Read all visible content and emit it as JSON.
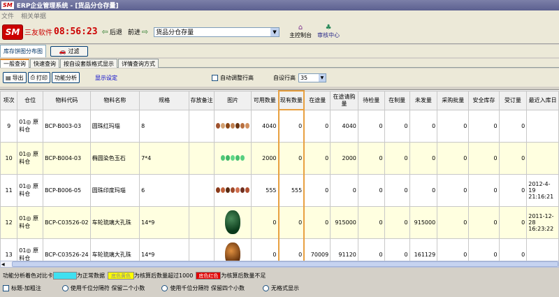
{
  "window": {
    "logo": "SM",
    "title": "ERP企业管理系统 - [货品分仓存量]"
  },
  "menu": {
    "items": [
      "文件",
      "相关单据"
    ]
  },
  "toolbar": {
    "brand_logo": "SM",
    "brand_name": "三友软件",
    "clock": "08:56:23",
    "back_label": "后退",
    "forward_label": "前进",
    "module_value": "货品分仓存量",
    "console_label": "主控制台",
    "audit_label": "审核中心"
  },
  "subbar": {
    "view_tab": "库存饼图分布图",
    "filter_label": "过滤"
  },
  "tabs": [
    "一般查询",
    "快速查询",
    "按自设套版格式显示",
    "详情查询方式"
  ],
  "actions": {
    "export_label": "导出",
    "print_label": "打印",
    "analysis_label": "功能分析",
    "show_settings": "显示设定",
    "auto_adjust_label": "自动调整行高",
    "row_height_label": "自设行高",
    "row_height_value": "35"
  },
  "table": {
    "columns": [
      "项次",
      "仓位",
      "物料代码",
      "物料名称",
      "规格",
      "存放备注",
      "图片",
      "可用数量",
      "现有数量",
      "在途量",
      "在途请购量",
      "待检量",
      "在制量",
      "未发量",
      "采购批量",
      "安全库存",
      "受订量",
      "最近入库日"
    ],
    "rows": [
      {
        "no": "9",
        "wh": "01◎ 原料仓",
        "code": "BCP-B003-03",
        "name": "圆珠红玛瑙",
        "spec": "8",
        "note": "",
        "img": "beads-brown",
        "avail": "4040",
        "onhand": "0",
        "transit": "0",
        "transit_req": "4040",
        "inspect": "0",
        "making": "0",
        "unsent": "0",
        "batch": "0",
        "safety": "0",
        "ordered": "0",
        "lastin": ""
      },
      {
        "no": "10",
        "wh": "01◎ 原料仓",
        "code": "BCP-B004-03",
        "name": "椭圆染色玉石",
        "spec": "7*4",
        "note": "",
        "img": "beads-green",
        "avail": "2000",
        "onhand": "0",
        "transit": "0",
        "transit_req": "2000",
        "inspect": "0",
        "making": "0",
        "unsent": "0",
        "batch": "0",
        "safety": "0",
        "ordered": "0",
        "lastin": ""
      },
      {
        "no": "11",
        "wh": "01◎ 原料仓",
        "code": "BCP-B006-05",
        "name": "圆珠印度玛瑙",
        "spec": "6",
        "note": "",
        "img": "beads-mixed",
        "avail": "555",
        "onhand": "555",
        "transit": "0",
        "transit_req": "0",
        "inspect": "0",
        "making": "0",
        "unsent": "0",
        "batch": "0",
        "safety": "0",
        "ordered": "0",
        "lastin": "2012-4-19 21:16:21"
      },
      {
        "no": "12",
        "wh": "01◎ 原料仓",
        "code": "BCP-C03526-02",
        "name": "车轮琉璃大孔珠",
        "spec": "14*9",
        "note": "",
        "img": "jewel-green",
        "avail": "0",
        "onhand": "0",
        "transit": "0",
        "transit_req": "915000",
        "inspect": "0",
        "making": "0",
        "unsent": "915000",
        "batch": "0",
        "safety": "0",
        "ordered": "0",
        "lastin": "2011-12-28 16:23:22"
      },
      {
        "no": "13",
        "wh": "01◎ 原料仓",
        "code": "BCP-C03526-24",
        "name": "车轮琉璃大孔珠",
        "spec": "14*9",
        "note": "",
        "img": "jewel-amber",
        "avail": "0",
        "onhand": "0",
        "transit": "70009",
        "transit_req": "91120",
        "inspect": "0",
        "making": "0",
        "unsent": "161129",
        "batch": "0",
        "safety": "0",
        "ordered": "0",
        "lastin": ""
      }
    ]
  },
  "legend": {
    "prefix": "功能分析着色对比卡",
    "cyan_swatch": "",
    "cyan_text": "为正常数据",
    "yellow_swatch": "底色黄色",
    "yellow_text": "为核算后数量超过1000",
    "red_swatch": "底色红色",
    "red_text": "为核算后数量不足",
    "colors": {
      "cyan": "#40e0f0",
      "yellow": "#ffff00",
      "red": "#e00000"
    }
  },
  "bottom": {
    "title_bold": "标题-加粗注",
    "opt1": "使用千位分隔符 保留二个小数",
    "opt2": "使用千位分隔符 保留四个小数",
    "opt3": "无格式显示"
  }
}
